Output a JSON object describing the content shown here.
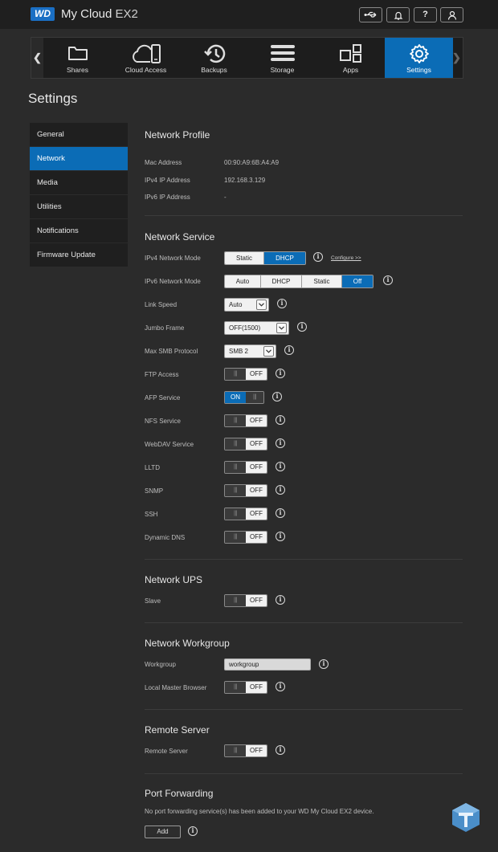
{
  "header": {
    "logo_text": "WD",
    "brand_name": "My Cloud",
    "brand_model": "EX2",
    "help_label": "?"
  },
  "nav": {
    "items": [
      {
        "label": "Shares",
        "icon": "folder-icon"
      },
      {
        "label": "Cloud Access",
        "icon": "cloud-device-icon"
      },
      {
        "label": "Backups",
        "icon": "history-icon"
      },
      {
        "label": "Storage",
        "icon": "storage-icon"
      },
      {
        "label": "Apps",
        "icon": "apps-icon"
      },
      {
        "label": "Settings",
        "icon": "gear-icon"
      }
    ],
    "active": "Settings"
  },
  "page_title": "Settings",
  "sidebar": {
    "items": [
      "General",
      "Network",
      "Media",
      "Utilities",
      "Notifications",
      "Firmware Update"
    ],
    "active": "Network"
  },
  "network_profile": {
    "title": "Network Profile",
    "mac_label": "Mac Address",
    "mac_value": "00:90:A9:6B:A4:A9",
    "ipv4_label": "IPv4 IP Address",
    "ipv4_value": "192.168.3.129",
    "ipv6_label": "IPv6 IP Address",
    "ipv6_value": "-"
  },
  "network_service": {
    "title": "Network Service",
    "ipv4_mode_label": "IPv4 Network Mode",
    "ipv4_mode_options": [
      "Static",
      "DHCP"
    ],
    "ipv4_mode_selected": "DHCP",
    "configure_link": "Configure >>",
    "ipv6_mode_label": "IPv6 Network Mode",
    "ipv6_mode_options": [
      "Auto",
      "DHCP",
      "Static",
      "Off"
    ],
    "ipv6_mode_selected": "Off",
    "link_speed_label": "Link Speed",
    "link_speed_value": "Auto",
    "jumbo_label": "Jumbo Frame",
    "jumbo_value": "OFF(1500)",
    "smb_label": "Max SMB Protocol",
    "smb_value": "SMB 2",
    "ftp_label": "FTP Access",
    "ftp_state": "OFF",
    "afp_label": "AFP Service",
    "afp_state": "ON",
    "nfs_label": "NFS Service",
    "nfs_state": "OFF",
    "webdav_label": "WebDAV Service",
    "webdav_state": "OFF",
    "lltd_label": "LLTD",
    "lltd_state": "OFF",
    "snmp_label": "SNMP",
    "snmp_state": "OFF",
    "ssh_label": "SSH",
    "ssh_state": "OFF",
    "ddns_label": "Dynamic DNS",
    "ddns_state": "OFF"
  },
  "network_ups": {
    "title": "Network UPS",
    "slave_label": "Slave",
    "slave_state": "OFF"
  },
  "network_workgroup": {
    "title": "Network Workgroup",
    "workgroup_label": "Workgroup",
    "workgroup_value": "workgroup",
    "lmb_label": "Local Master Browser",
    "lmb_state": "OFF"
  },
  "remote_server": {
    "title": "Remote Server",
    "label": "Remote Server",
    "state": "OFF"
  },
  "port_forwarding": {
    "title": "Port Forwarding",
    "message": "No port forwarding service(s) has been added to your WD My Cloud EX2 device.",
    "add_label": "Add"
  },
  "toggle_grip": "|||",
  "info_glyph": "i"
}
